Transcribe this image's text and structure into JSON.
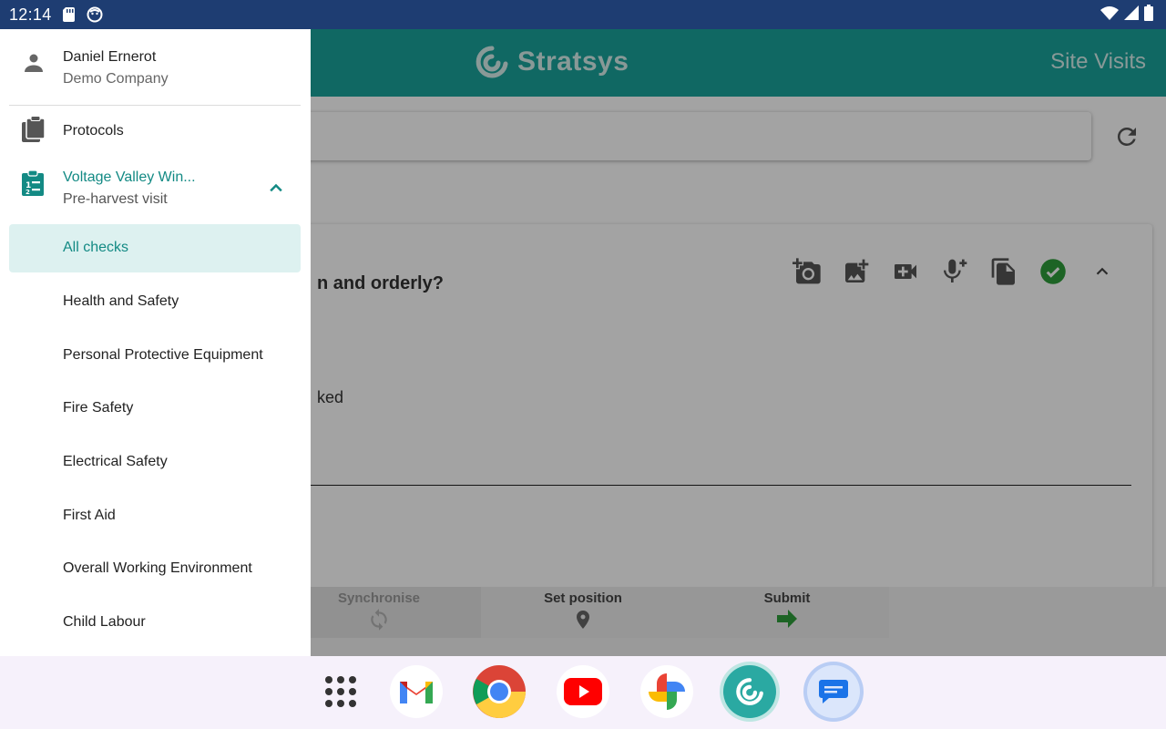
{
  "status_bar": {
    "time": "12:14"
  },
  "app_bar": {
    "logo_text": "Stratsys",
    "title": "Site Visits"
  },
  "card": {
    "question": "n and orderly?",
    "answer": "ked"
  },
  "bottom_bar": {
    "synchronise": "Synchronise",
    "set_position": "Set position",
    "submit": "Submit"
  },
  "drawer": {
    "user_name": "Daniel Ernerot",
    "company": "Demo Company",
    "protocols": "Protocols",
    "visit_title": "Voltage Valley Win...",
    "visit_subtitle": "Pre-harvest visit",
    "checks": [
      "All checks",
      "Health and Safety",
      "Personal Protective Equipment",
      "Fire Safety",
      "Electrical Safety",
      "First Aid",
      "Overall Working Environment",
      "Child Labour"
    ]
  },
  "colors": {
    "teal": "#19a39b",
    "teal_text": "#138a84",
    "active_bg": "#ddf1f0",
    "status_bar": "#1e3d72",
    "check_green": "#2e9d3a"
  },
  "dock": {
    "apps": [
      "app-drawer-icon",
      "gmail-icon",
      "chrome-icon",
      "youtube-icon",
      "photos-icon",
      "stratsys-icon",
      "messages-icon"
    ]
  }
}
